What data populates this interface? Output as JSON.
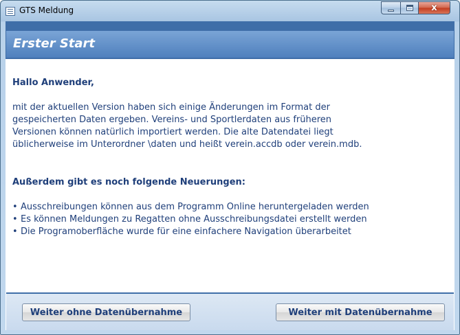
{
  "window": {
    "title": "GTS Meldung",
    "close_glyph": "x",
    "icons": [
      "app-icon",
      "minimize-icon",
      "maximize-icon",
      "close-icon"
    ]
  },
  "header": {
    "title": "Erster Start",
    "color": "#4f80bd"
  },
  "content": {
    "greeting": "Hallo Anwender,",
    "paragraph_lines": [
      "mit der aktuellen Version haben sich einige Änderungen im Format der",
      "gespeicherten Daten ergeben. Vereins- und Sportlerdaten aus früheren",
      "Versionen können natürlich importiert werden. Die alte Datendatei liegt",
      "üblicherweise im Unterordner \\daten und heißt verein.accdb oder verein.mdb."
    ],
    "subheading": "Außerdem gibt es noch folgende Neuerungen:",
    "bullet": "•",
    "features": [
      "Ausschreibungen können aus dem Programm Online heruntergeladen werden",
      "Es können Meldungen zu Regatten ohne Ausschreibungsdatei erstellt werden",
      "Die Programoberfläche wurde für eine einfachere Navigation überarbeitet"
    ],
    "text_color": "#1f3f7a"
  },
  "footer": {
    "continue_without_label": "Weiter ohne Datenübernahme",
    "continue_with_label": "Weiter mit Datenübernahme"
  }
}
